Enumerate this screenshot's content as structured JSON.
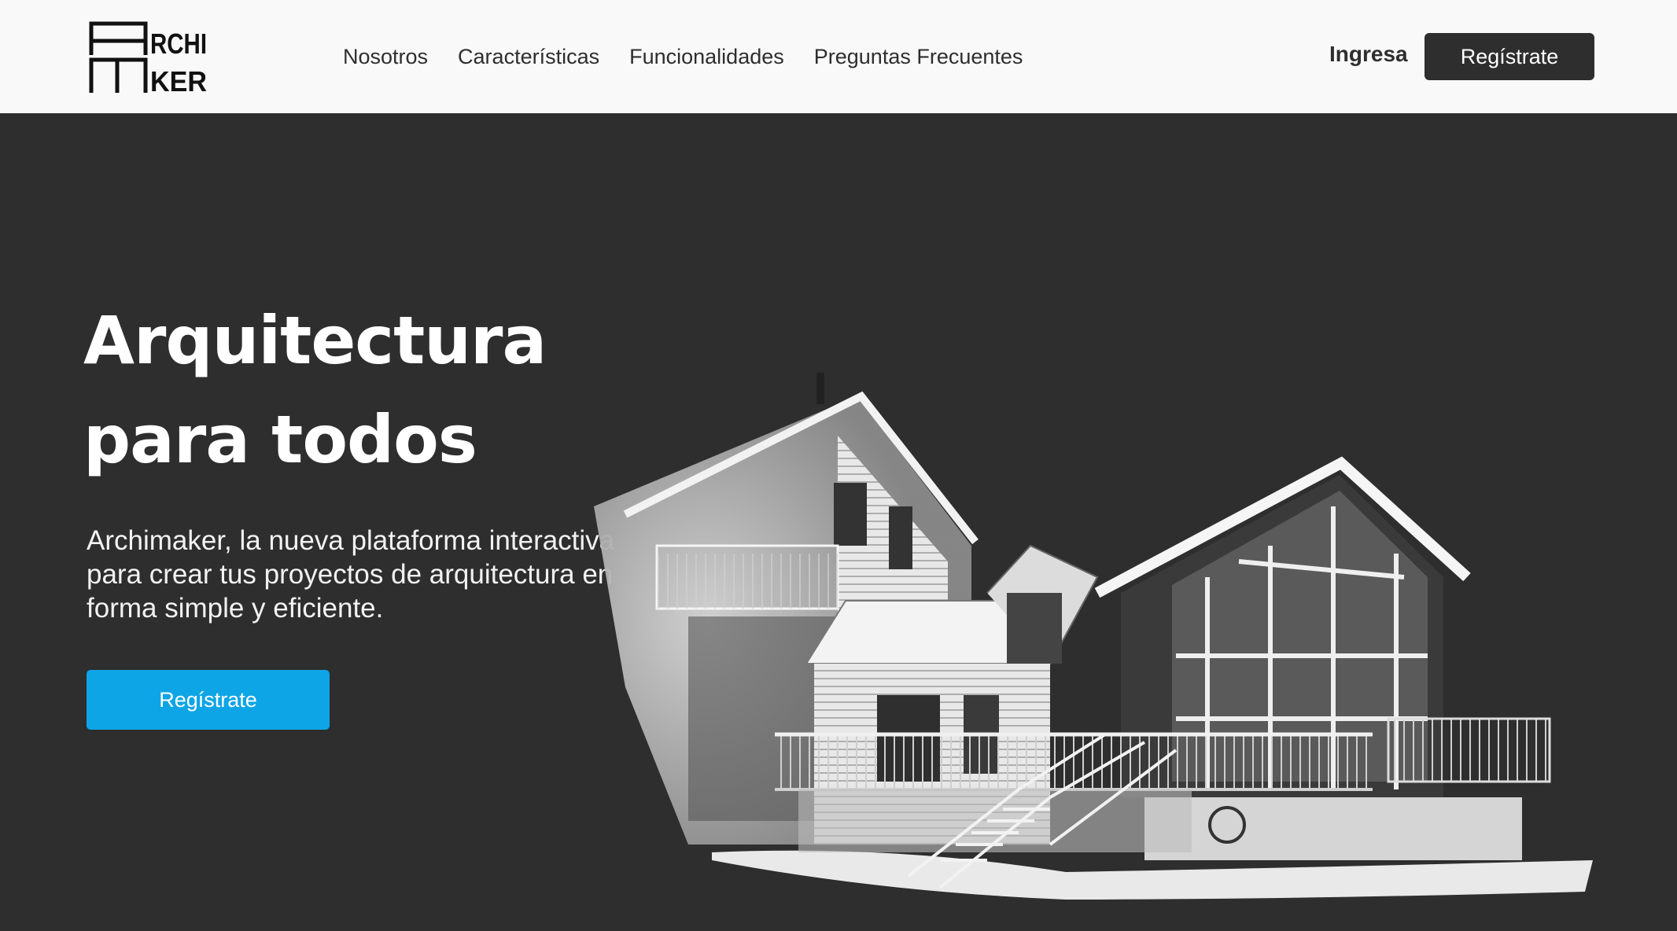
{
  "brand": {
    "logo_text_line1": "ARCHI",
    "logo_text_line2": "MAKER"
  },
  "nav": {
    "items": [
      {
        "label": "Nosotros"
      },
      {
        "label": "Características"
      },
      {
        "label": "Funcionalidades"
      },
      {
        "label": "Preguntas Frecuentes"
      }
    ],
    "login_label": "Ingresa",
    "signup_label": "Regístrate"
  },
  "hero": {
    "title_line1": "Arquitectura",
    "title_line2": "para todos",
    "subtitle": "Archimaker, la nueva plataforma interactiva para crear tus proyectos de arquitectura en forma simple y eficiente.",
    "cta_label": "Regístrate",
    "illustration": "house-sketch"
  },
  "colors": {
    "header_bg": "#f9f9f9",
    "hero_bg": "#2e2e2e",
    "dark_button": "#2e2e2e",
    "accent": "#0ea5e6",
    "text_light": "#ffffff"
  }
}
